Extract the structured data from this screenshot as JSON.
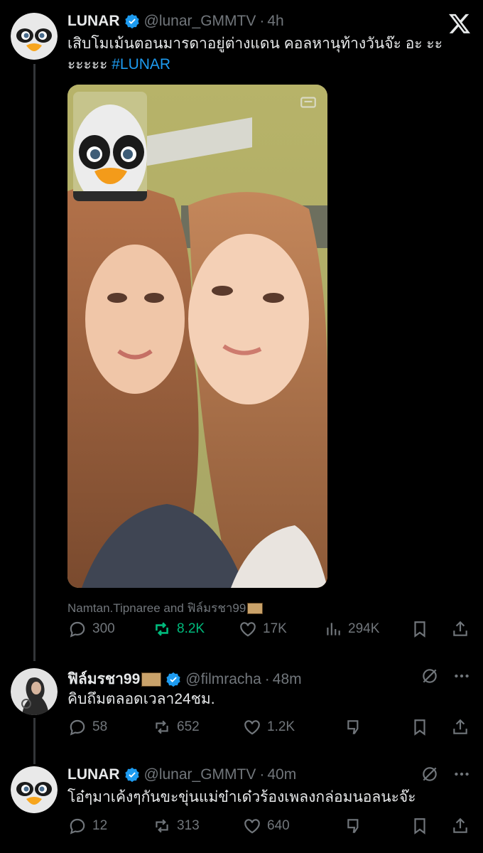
{
  "header": {
    "close_icon": "x-logo-icon"
  },
  "posts": [
    {
      "display_name": "LUNAR",
      "handle": "@lunar_GMMTV",
      "time": "4h",
      "text_main": "เสิบโมเม้นตอนมารดาอยู่ต่างแดน คอลหานุท้างวันจ๊ะ อะ ะะ ะะะะะ ",
      "hashtag": "#LUNAR",
      "tagged": "Namtan.Tipnaree and ฟิล์มรชา99",
      "stats": {
        "replies": "300",
        "reposts": "8.2K",
        "likes": "17K",
        "views": "294K"
      }
    },
    {
      "display_name": "ฟิล์มรชา99",
      "handle": "@filmracha",
      "time": "48m",
      "text": "คิบถึมตลอดเวลา24ชม.",
      "stats": {
        "replies": "58",
        "reposts": "652",
        "likes": "1.2K"
      }
    },
    {
      "display_name": "LUNAR",
      "handle": "@lunar_GMMTV",
      "time": "40m",
      "text": "โอ๋ๆมาเค้งๆกันขะขุ่นแม่ข๋าเด๋วร้องเพลงกล่อมนอลนะจ๊ะ",
      "stats": {
        "replies": "12",
        "reposts": "313",
        "likes": "640"
      }
    }
  ],
  "colors": {
    "background": "#000000",
    "text": "#e7e9ea",
    "muted": "#71767b",
    "accent": "#1d9bf0",
    "repost_active": "#00ba7c"
  }
}
